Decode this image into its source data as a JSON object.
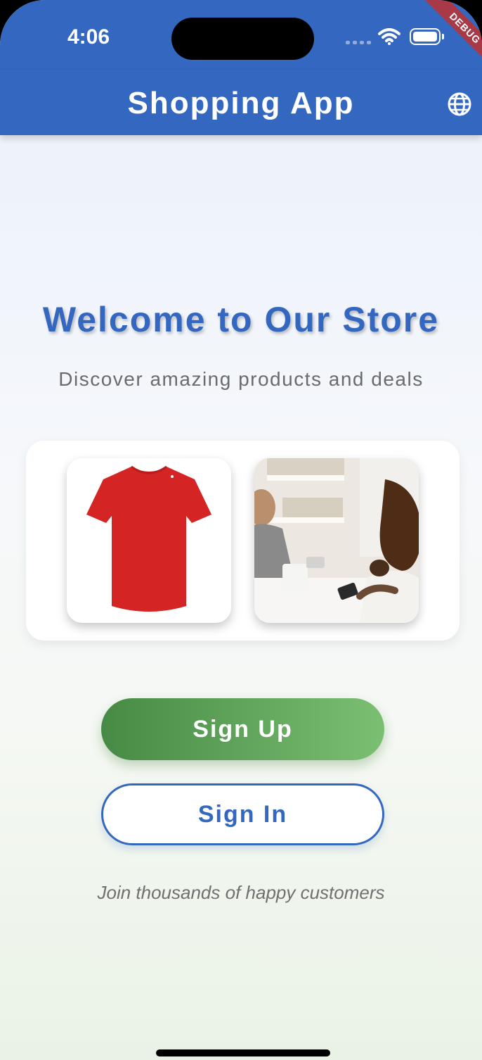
{
  "status_bar": {
    "time": "4:06",
    "debug_banner": "DEBUG"
  },
  "app_bar": {
    "title": "Shopping App",
    "language_icon": "globe-icon"
  },
  "hero": {
    "title": "Welcome to Our Store",
    "subtitle": "Discover amazing products and deals"
  },
  "showcase": {
    "images": [
      {
        "name": "red-tshirt"
      },
      {
        "name": "store-checkout"
      }
    ]
  },
  "actions": {
    "sign_up_label": "Sign Up",
    "sign_in_label": "Sign In"
  },
  "footer": {
    "tagline": "Join thousands of happy customers"
  },
  "colors": {
    "primary": "#3468c0",
    "sign_up_gradient_start": "#468a45",
    "sign_up_gradient_end": "#7bbf73"
  }
}
